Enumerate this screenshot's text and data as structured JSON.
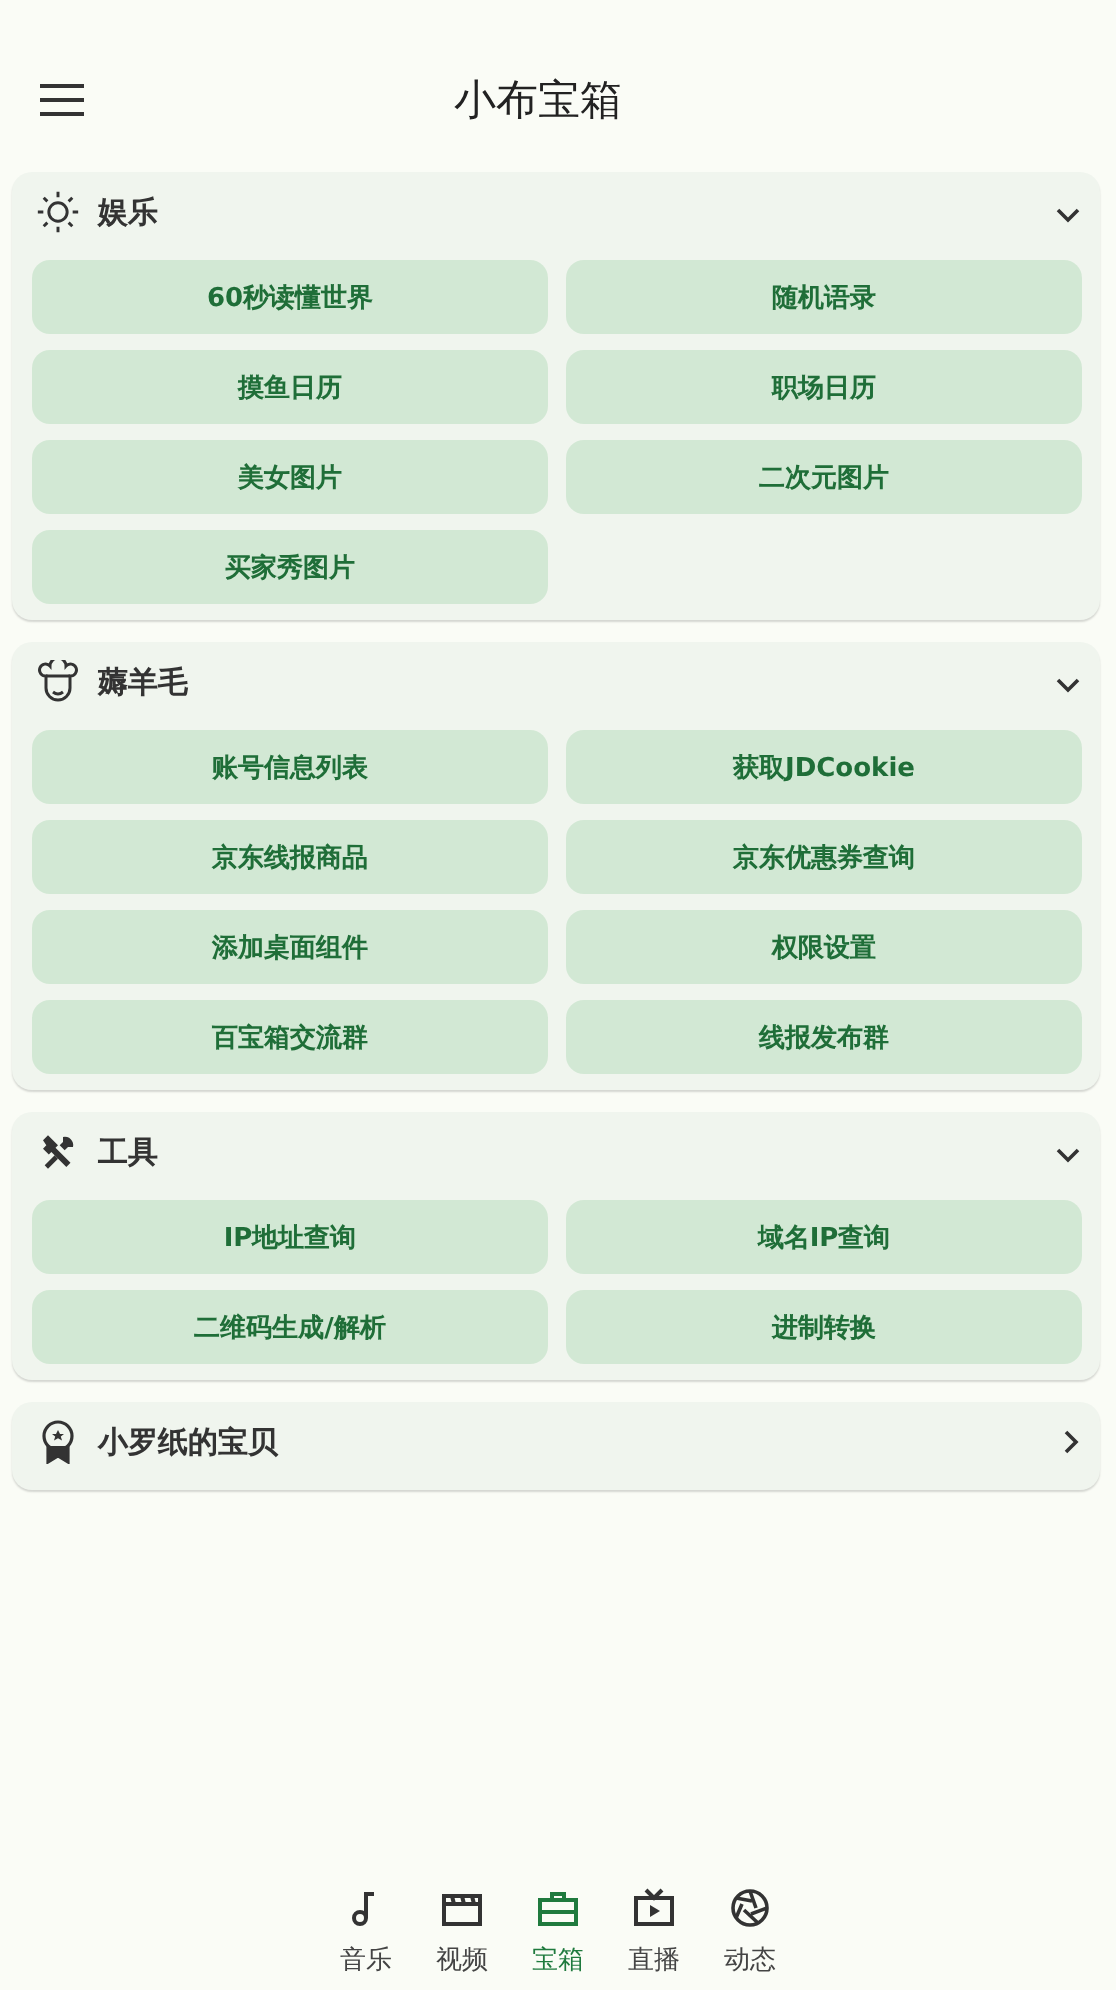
{
  "app_bar": {
    "title": "小布宝箱"
  },
  "sections": [
    {
      "title": "娱乐",
      "expanded": true,
      "items": [
        "60秒读懂世界",
        "随机语录",
        "摸鱼日历",
        "职场日历",
        "美女图片",
        "二次元图片",
        "买家秀图片"
      ]
    },
    {
      "title": "薅羊毛",
      "expanded": true,
      "items": [
        "账号信息列表",
        "获取JDCookie",
        "京东线报商品",
        "京东优惠券查询",
        "添加桌面组件",
        "权限设置",
        "百宝箱交流群",
        "线报发布群"
      ]
    },
    {
      "title": "工具",
      "expanded": true,
      "items": [
        "IP地址查询",
        "域名IP查询",
        "二维码生成/解析",
        "进制转换"
      ]
    },
    {
      "title": "小罗纸的宝贝",
      "expanded": false
    }
  ],
  "bottom_nav": [
    {
      "label": "音乐",
      "selected": false
    },
    {
      "label": "视频",
      "selected": false
    },
    {
      "label": "宝箱",
      "selected": true
    },
    {
      "label": "直播",
      "selected": false
    },
    {
      "label": "动态",
      "selected": false
    }
  ]
}
